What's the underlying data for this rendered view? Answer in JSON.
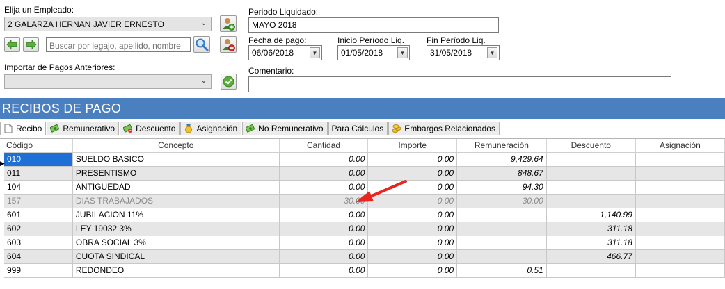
{
  "empleado": {
    "label": "Elija un Empleado:",
    "selected": "2 GALARZA HERNAN JAVIER ERNESTO",
    "search_placeholder": "Buscar por legajo, apellido, nombre"
  },
  "importar": {
    "label": "Importar de Pagos Anteriores:",
    "selected": ""
  },
  "periodo": {
    "label": "Periodo Liquidado:",
    "value": "MAYO 2018"
  },
  "fecha_pago": {
    "label": "Fecha de pago:",
    "value": "06/06/2018"
  },
  "inicio": {
    "label": "Inicio Período Liq.",
    "value": "01/05/2018"
  },
  "fin": {
    "label": "Fin Período Liq.",
    "value": "31/05/2018"
  },
  "comentario": {
    "label": "Comentario:",
    "value": ""
  },
  "section_title": "RECIBOS DE PAGO",
  "tabs": [
    {
      "label": "Recibo",
      "icon": "page-icon"
    },
    {
      "label": "Remunerativo",
      "icon": "money-icon"
    },
    {
      "label": "Descuento",
      "icon": "money-minus-icon"
    },
    {
      "label": "Asignación",
      "icon": "medal-icon"
    },
    {
      "label": "No Remunerativo",
      "icon": "money-icon"
    },
    {
      "label": "Para Cálculos",
      "icon": ""
    },
    {
      "label": "Embargos Relacionados",
      "icon": "coins-icon"
    }
  ],
  "grid": {
    "columns": [
      "Código",
      "Concepto",
      "Cantidad",
      "Importe",
      "Remuneración",
      "Descuento",
      "Asignación"
    ],
    "rows": [
      {
        "codigo": "010",
        "concepto": "SUELDO BASICO",
        "cantidad": "0.00",
        "importe": "0.00",
        "remuneracion": "9,429.64",
        "descuento": "",
        "asignacion": ""
      },
      {
        "codigo": "011",
        "concepto": "PRESENTISMO",
        "cantidad": "0.00",
        "importe": "0.00",
        "remuneracion": "848.67",
        "descuento": "",
        "asignacion": ""
      },
      {
        "codigo": "104",
        "concepto": "ANTIGUEDAD",
        "cantidad": "0.00",
        "importe": "0.00",
        "remuneracion": "94.30",
        "descuento": "",
        "asignacion": ""
      },
      {
        "codigo": "157",
        "concepto": "DIAS TRABAJADOS",
        "cantidad": "30.00",
        "importe": "0.00",
        "remuneracion": "30.00",
        "descuento": "",
        "asignacion": ""
      },
      {
        "codigo": "601",
        "concepto": " JUBILACION 11%",
        "cantidad": "0.00",
        "importe": "0.00",
        "remuneracion": "",
        "descuento": "1,140.99",
        "asignacion": ""
      },
      {
        "codigo": "602",
        "concepto": " LEY 19032 3%",
        "cantidad": "0.00",
        "importe": "0.00",
        "remuneracion": "",
        "descuento": "311.18",
        "asignacion": ""
      },
      {
        "codigo": "603",
        "concepto": " OBRA SOCIAL 3%",
        "cantidad": "0.00",
        "importe": "0.00",
        "remuneracion": "",
        "descuento": "311.18",
        "asignacion": ""
      },
      {
        "codigo": "604",
        "concepto": " CUOTA SINDICAL",
        "cantidad": "0.00",
        "importe": "0.00",
        "remuneracion": "",
        "descuento": "466.77",
        "asignacion": ""
      },
      {
        "codigo": "999",
        "concepto": "REDONDEO",
        "cantidad": "0.00",
        "importe": "0.00",
        "remuneracion": "0.51",
        "descuento": "",
        "asignacion": ""
      }
    ]
  },
  "colors": {
    "header_bar": "#4a7fc0",
    "selection": "#1e6fd6",
    "annotation_arrow": "#e8251f"
  }
}
